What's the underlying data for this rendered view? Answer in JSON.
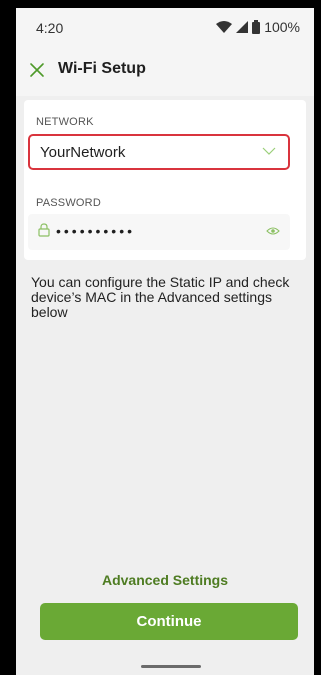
{
  "status_bar": {
    "time": "4:20",
    "battery": "100%",
    "icons": [
      "wifi-icon",
      "cellular-signal-icon",
      "battery-icon"
    ]
  },
  "header": {
    "title": "Wi-Fi Setup",
    "close_icon": "close-icon"
  },
  "form": {
    "network_label": "NETWORK",
    "network_value": "YourNetwork",
    "password_label": "PASSWORD",
    "password_value": "••••••••••",
    "lock_icon": "lock-icon",
    "eye_icon": "eye-icon",
    "chevron_icon": "chevron-down-icon"
  },
  "info_text": "You can configure the Static IP and check device’s MAC in the Advanced settings below",
  "advanced_settings_label": "Advanced Settings",
  "continue_label": "Continue",
  "colors": {
    "accent_green": "#6aa935",
    "link_green": "#4e7c22",
    "error_red": "#d9343d",
    "background": "#efefef"
  }
}
